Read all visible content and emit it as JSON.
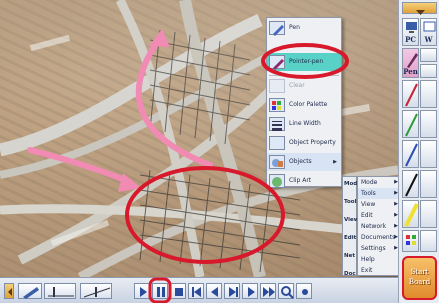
{
  "pen_menu": {
    "items": [
      {
        "label": "Pen",
        "icon": "pen-icon",
        "state": "normal"
      },
      {
        "label": "Pointer-pen",
        "icon": "pointer-pen-icon",
        "state": "selected"
      },
      {
        "label": "Clear",
        "icon": "clear-icon",
        "state": "disabled"
      },
      {
        "label": "Color Palette",
        "icon": "color-palette-icon",
        "state": "normal"
      },
      {
        "label": "Line Width",
        "icon": "line-width-icon",
        "state": "normal"
      },
      {
        "label": "Object Property",
        "icon": "object-property-icon",
        "state": "normal"
      },
      {
        "label": "Objects",
        "icon": "objects-icon",
        "state": "highlight",
        "arrow": "▶"
      },
      {
        "label": "Clip Art",
        "icon": "clip-art-icon",
        "state": "normal"
      }
    ]
  },
  "main_menu": {
    "categories": [
      "Mode",
      "Tool",
      "View",
      "Edit",
      "Net",
      "Doc"
    ],
    "items": [
      {
        "label": "Mode",
        "icon": "mode-icon",
        "arrow": "▶"
      },
      {
        "label": "Tools",
        "icon": "tools-icon",
        "arrow": "▶"
      },
      {
        "label": "View",
        "icon": "view-icon",
        "arrow": "▶"
      },
      {
        "label": "Edit",
        "icon": "edit-icon",
        "arrow": "▶"
      },
      {
        "label": "Network",
        "icon": "network-icon",
        "arrow": "▶"
      },
      {
        "label": "Documents",
        "icon": "documents-icon",
        "arrow": "▶"
      },
      {
        "label": "Settings",
        "icon": "settings-icon",
        "arrow": "▶"
      },
      {
        "label": "Help",
        "icon": "help-icon",
        "arrow": ""
      },
      {
        "label": "Exit",
        "icon": "exit-icon",
        "arrow": ""
      }
    ]
  },
  "right_toolbar": {
    "pc_label": "PC",
    "w_label": "W",
    "pen_label": "Pen",
    "start_label_1": "Start",
    "start_label_2": "Board"
  },
  "colors": {
    "highlight_red": "#d8182b",
    "arrow_pink": "#f28bb4",
    "selected_teal": "#58d2c7"
  }
}
